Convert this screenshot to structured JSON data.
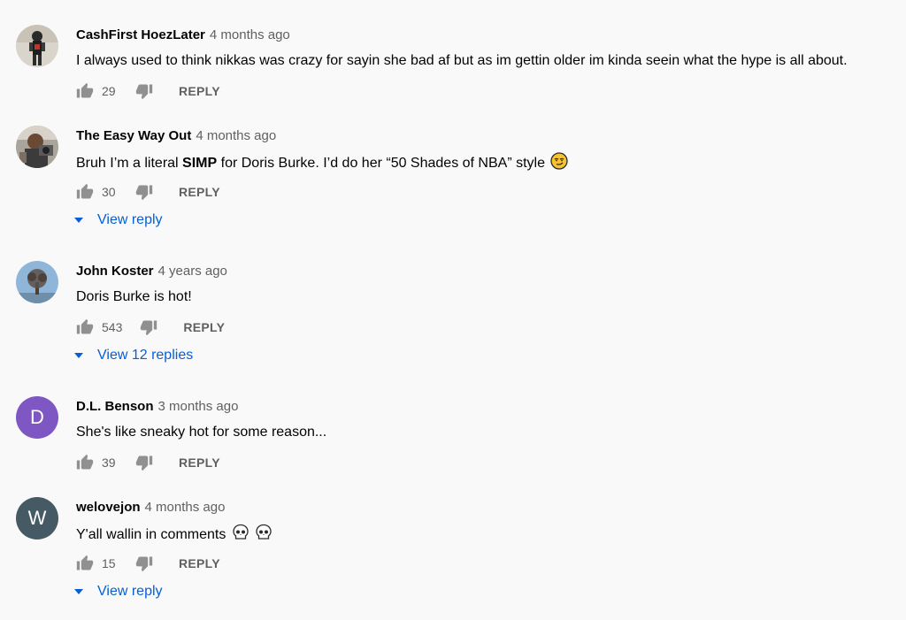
{
  "comments": [
    {
      "author": "CashFirst HoezLater",
      "time": "4 months ago",
      "text": "I always used to think nikkas was crazy for sayin she bad af but as im gettin older im kinda seein what the hype is all about.",
      "likes": "29",
      "reply_label": "REPLY",
      "avatar_icon": "person-photo-avatar"
    },
    {
      "author": "The Easy Way Out",
      "time": "4 months ago",
      "text_before": "Bruh I’m a literal ",
      "text_bold": "SIMP",
      "text_after": " for Doris Burke. I’d do her “50 Shades of NBA” style",
      "emoji": "smirk-emoji",
      "likes": "30",
      "reply_label": "REPLY",
      "view_replies": "View reply",
      "avatar_icon": "person-photo-avatar"
    },
    {
      "author": "John Koster",
      "time": "4 years ago",
      "text": "Doris Burke is hot!",
      "likes": "543",
      "reply_label": "REPLY",
      "view_replies": "View 12 replies",
      "avatar_icon": "tree-photo-avatar"
    },
    {
      "author": "D.L. Benson",
      "time": "3 months ago",
      "text": "She's like sneaky hot for some reason...",
      "likes": "39",
      "reply_label": "REPLY",
      "avatar_letter": "D",
      "avatar_color": "#7e57c2"
    },
    {
      "author": "welovejon",
      "time": "4 months ago",
      "text": "Y'all wallin in comments",
      "emoji": "skull-emoji",
      "likes": "15",
      "reply_label": "REPLY",
      "view_replies": "View reply",
      "avatar_letter": "W",
      "avatar_color": "#455a64"
    }
  ],
  "colors": {
    "background": "#f9f9f9",
    "link_blue": "#065fd4",
    "secondary_text": "#606060",
    "primary_text": "#030303"
  }
}
